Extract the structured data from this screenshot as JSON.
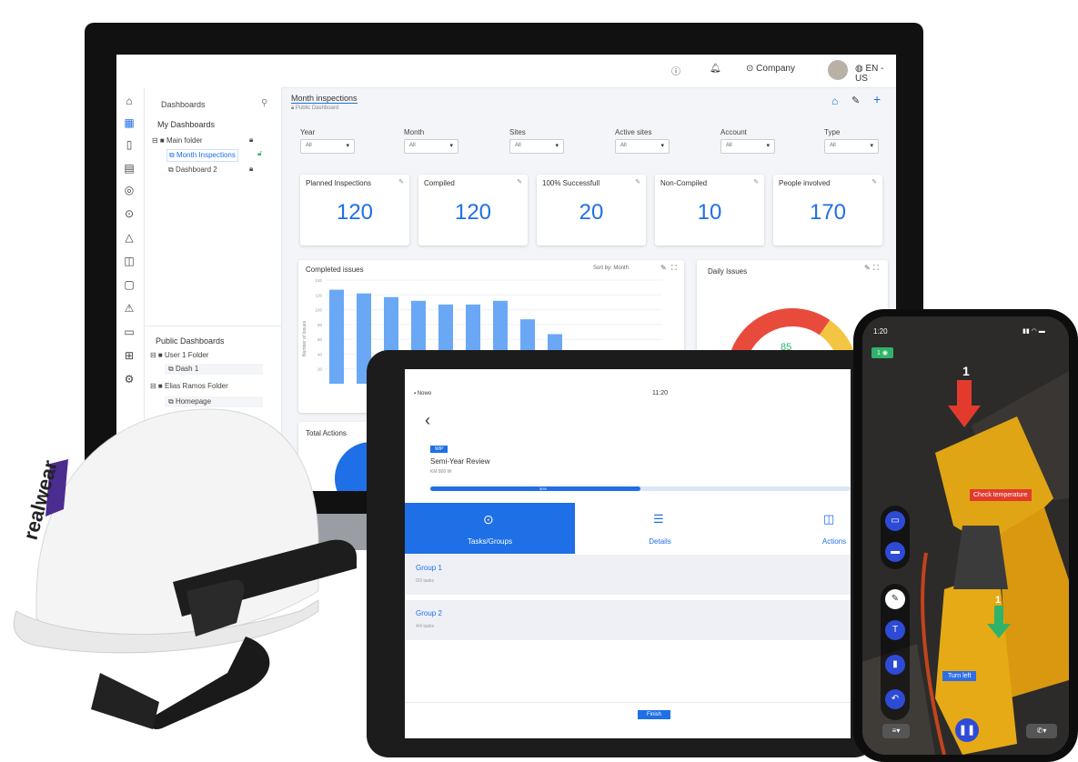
{
  "monitor": {
    "topbar": {
      "info_icon": "info-icon",
      "bell_icon": "bell-icon",
      "company": "Company",
      "lang": "EN - US"
    },
    "rail_icons": [
      "home-icon",
      "grid-icon",
      "file-icon",
      "clipboard-icon",
      "globe-icon",
      "pin-icon",
      "shapes-icon",
      "book-icon",
      "tablet-icon",
      "warning-icon",
      "card-icon",
      "plus-box-icon",
      "gear-icon"
    ],
    "panel": {
      "title": "Dashboards",
      "my_dashboards": "My Dashboards",
      "main_folder": "Main folder",
      "month_inspections": "Month Inspections",
      "dashboard2": "Dashboard 2",
      "public_dashboards": "Public Dashboards",
      "user1_folder": "User 1 Folder",
      "dash1": "Dash 1",
      "elias_folder": "Elias Ramos Folder",
      "homepage": "Homepage"
    },
    "main": {
      "title": "Month inspections",
      "subtitle": "Public Dashboard",
      "filters": [
        {
          "label": "Year",
          "value": "All"
        },
        {
          "label": "Month",
          "value": "All"
        },
        {
          "label": "Sites",
          "value": "All"
        },
        {
          "label": "Active sites",
          "value": "All"
        },
        {
          "label": "Account",
          "value": "All"
        },
        {
          "label": "Type",
          "value": "All"
        }
      ],
      "kpis": [
        {
          "title": "Planned Inspections",
          "value": "120"
        },
        {
          "title": "Compiled",
          "value": "120"
        },
        {
          "title": "100% Successfull",
          "value": "20"
        },
        {
          "title": "Non-Compiled",
          "value": "10"
        },
        {
          "title": "People involved",
          "value": "170"
        }
      ],
      "completed_issues": "Completed issues",
      "sort_by": "Sort by: Month",
      "y_axis_label": "Number of Issues",
      "daily_issues": "Daily Issues",
      "donut_value": "85",
      "total_actions": "Total Actions"
    },
    "chart_data": {
      "type": "bar",
      "title": "Completed issues",
      "ylabel": "Number of Issues",
      "ylim": [
        0,
        140
      ],
      "yticks": [
        "140",
        "120",
        "100",
        "80",
        "60",
        "40",
        "20"
      ],
      "values": [
        127,
        122,
        117,
        112,
        107,
        107,
        112,
        87,
        67
      ],
      "color": "#6aa8f5"
    },
    "donut_data": {
      "segments": [
        {
          "value": 50,
          "color": "#e84b3c"
        },
        {
          "value": 18,
          "color": "#f4c542"
        },
        {
          "value": 22,
          "color": "#3cc36b"
        }
      ]
    }
  },
  "tablet": {
    "status_left": "Nowo",
    "status_time": "11:20",
    "badge": "WIP",
    "title": "Semi-Year Review",
    "subtitle": "KM 800 W",
    "progress": 0.5,
    "progress_text": "50%",
    "tabs": [
      {
        "label": "Tasks/Groups",
        "icon": "play-circle-icon"
      },
      {
        "label": "Details",
        "icon": "list-icon"
      },
      {
        "label": "Actions",
        "icon": "book-open-icon"
      }
    ],
    "groups": [
      {
        "title": "Group 1",
        "sub": "0/3 tasks"
      },
      {
        "title": "Group 2",
        "sub": "4/4 tasks"
      }
    ],
    "finish": "Finish"
  },
  "phone": {
    "time": "1:20",
    "counter_badge": "1",
    "annotation_1": "1",
    "check_label": "Check temperature",
    "annotation_2": "1",
    "turn_label": "Turn left",
    "colors": {
      "red": "#e23b2e",
      "green": "#2fb36b",
      "blue": "#2e4bd6"
    }
  },
  "helmet": {
    "brand": "realwear"
  }
}
